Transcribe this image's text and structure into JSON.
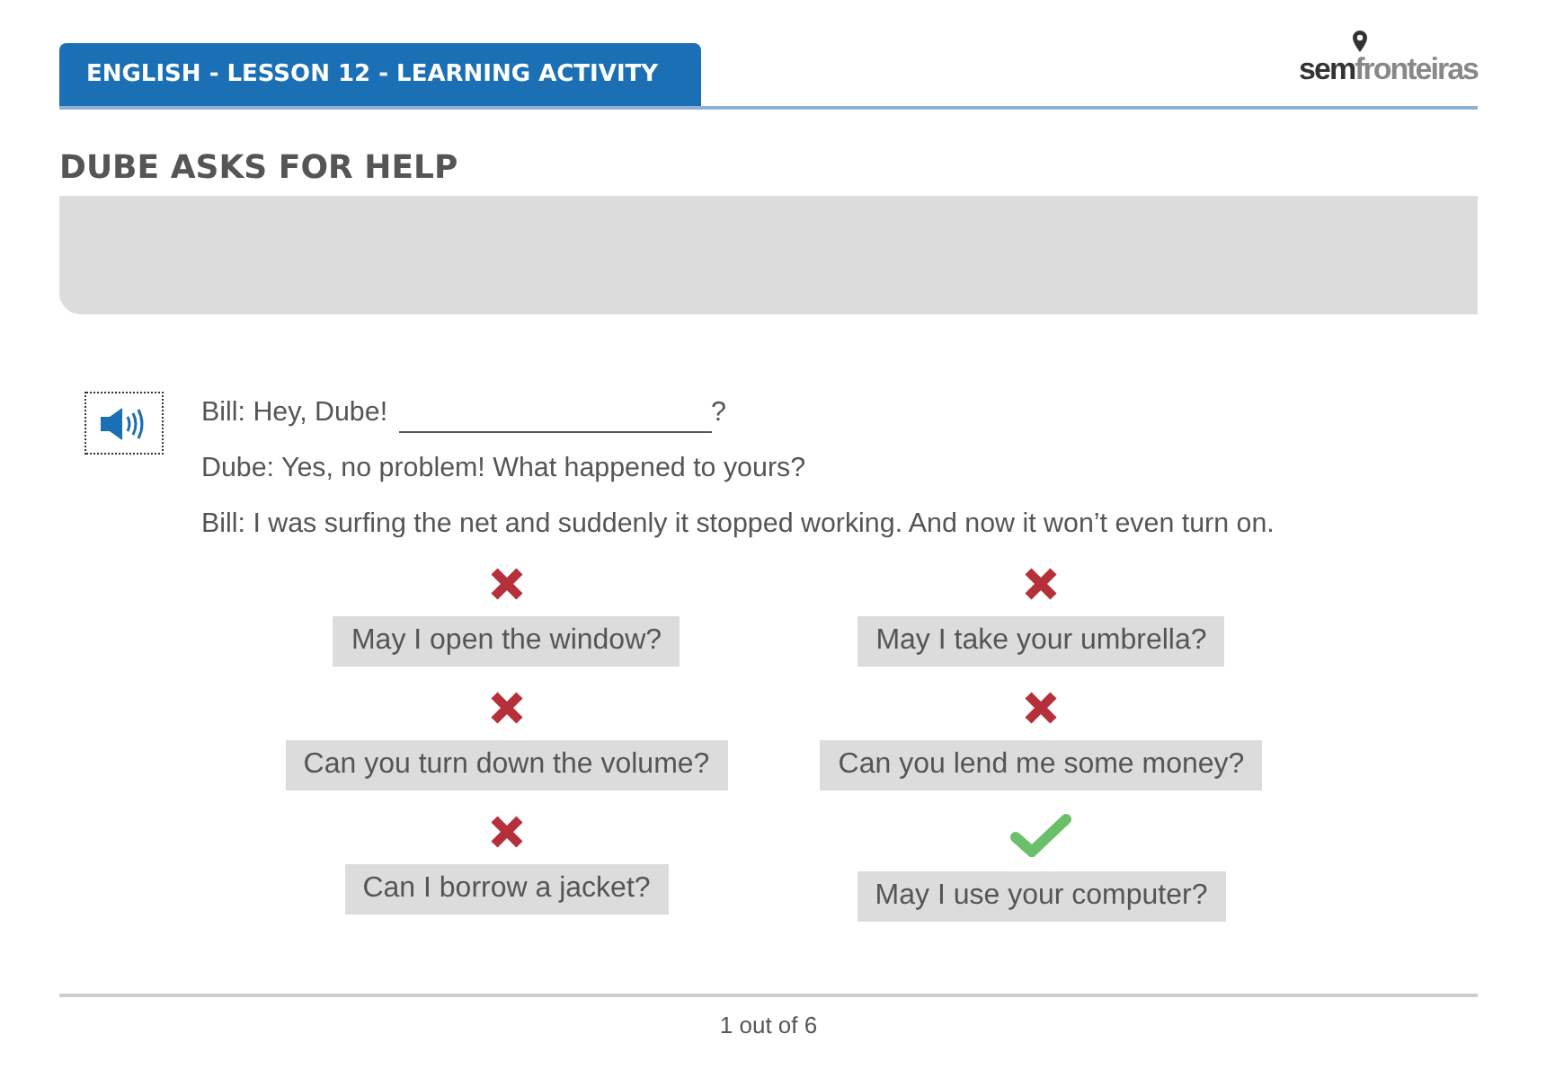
{
  "header": {
    "title": "ENGLISH - LESSON 12 - LEARNING ACTIVITY",
    "logo": "**sem**fronteiras"
  },
  "activity": {
    "title": "DUBE ASKS FOR HELP"
  },
  "dialogue": [
    {
      "kind": "blank",
      "text": "Bill: Hey, Dube!",
      "end": "?"
    },
    {
      "kind": "line",
      "text": "Dube: Yes, no problem! What happened to yours?"
    },
    {
      "kind": "line",
      "text": "Bill: I was surfing the net and suddenly it stopped working. And now it won’t even turn on."
    }
  ],
  "options": [
    {
      "text": "May I open the window?",
      "correct": false
    },
    {
      "text": "May I take your umbrella?",
      "correct": false
    },
    {
      "text": "Can you turn down the volume?",
      "correct": false
    },
    {
      "text": "Can you lend me some money?",
      "correct": false
    },
    {
      "text": "Can I borrow a jacket?",
      "correct": false
    },
    {
      "text": "May I use your computer?",
      "correct": true
    }
  ],
  "pager": "1 out of 6"
}
